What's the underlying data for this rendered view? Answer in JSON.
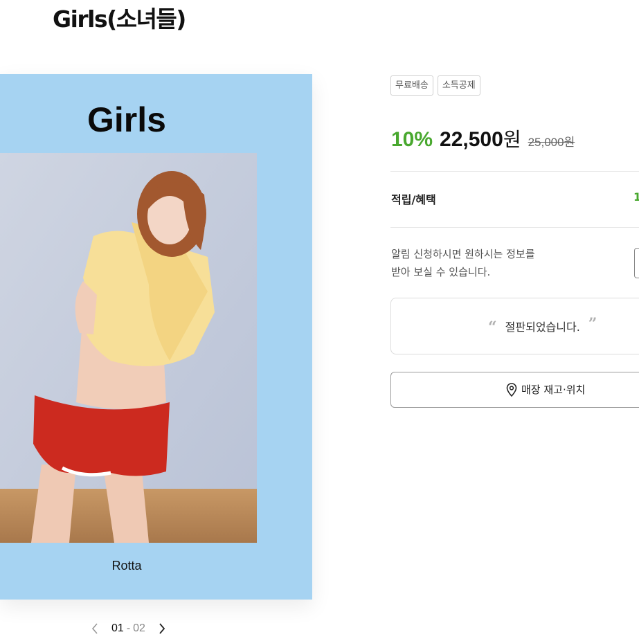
{
  "product": {
    "title": "Girls(소녀들)"
  },
  "cover": {
    "title": "Girls",
    "author": "Rotta",
    "background_color": "#a6d3f2"
  },
  "gallery": {
    "current": "01",
    "separator": "-",
    "total": "02",
    "prev_icon": "chevron-left-icon",
    "next_icon": "chevron-right-icon"
  },
  "badges": [
    "무료배송",
    "소득공제"
  ],
  "price": {
    "discount": "10%",
    "sale": "22,500",
    "currency": "원",
    "original": "25,000원",
    "discount_color": "#49a82f"
  },
  "benefit": {
    "label": "적립/혜택",
    "value": "1"
  },
  "notify": {
    "line1": "알림 신청하시면 원하시는 정보를",
    "line2": "받아 보실 수 있습니다."
  },
  "soldout": {
    "open_quote": "“",
    "text": "절판되었습니다.",
    "close_quote": "”"
  },
  "store": {
    "icon": "location-pin-icon",
    "label": "매장 재고·위치"
  }
}
